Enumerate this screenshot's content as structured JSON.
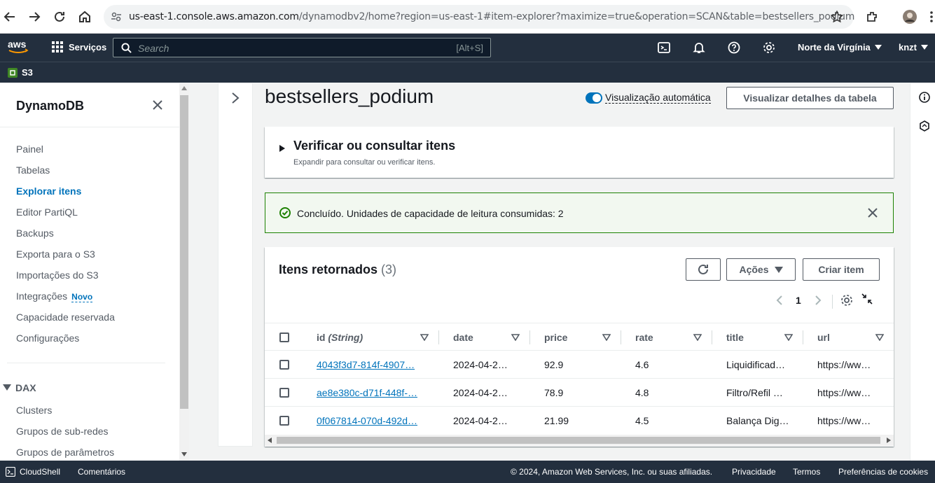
{
  "browser": {
    "url_host": "us-east-1.console.aws.amazon.com",
    "url_path": "/dynamodbv2/home?region=us-east-1#item-explorer?maximize=true&operation=SCAN&table=bestsellers_podium"
  },
  "header": {
    "logo": "aws",
    "services_label": "Serviços",
    "search_placeholder": "Search",
    "search_shortcut": "[Alt+S]",
    "region_label": "Norte da Virgínia",
    "user_label": "knzt"
  },
  "favorites": {
    "s3_label": "S3"
  },
  "sidebar": {
    "title": "DynamoDB",
    "items": [
      {
        "label": "Painel"
      },
      {
        "label": "Tabelas"
      },
      {
        "label": "Explorar itens"
      },
      {
        "label": "Editor PartiQL"
      },
      {
        "label": "Backups"
      },
      {
        "label": "Exporta para o S3"
      },
      {
        "label": "Importações do S3"
      },
      {
        "label": "Integrações",
        "badge": "Novo"
      },
      {
        "label": "Capacidade reservada"
      },
      {
        "label": "Configurações"
      }
    ],
    "dax_label": "DAX",
    "dax_items": [
      {
        "label": "Clusters"
      },
      {
        "label": "Grupos de sub-redes"
      },
      {
        "label": "Grupos de parâmetros"
      }
    ]
  },
  "main": {
    "table_name": "bestsellers_podium",
    "auto_view_label": "Visualização automática",
    "view_details_button": "Visualizar detalhes da tabela",
    "expand_title": "Verificar ou consultar itens",
    "expand_description": "Expandir para consultar ou verificar itens.",
    "flash_message": "Concluído. Unidades de capacidade de leitura consumidas: 2",
    "results_title": "Itens retornados",
    "results_count": "(3)",
    "actions_button": "Ações",
    "create_item_button": "Criar item",
    "page_number": "1",
    "columns": [
      {
        "name": "id",
        "type": "(String)"
      },
      {
        "name": "date",
        "type": ""
      },
      {
        "name": "price",
        "type": ""
      },
      {
        "name": "rate",
        "type": ""
      },
      {
        "name": "title",
        "type": ""
      },
      {
        "name": "url",
        "type": ""
      }
    ],
    "rows": [
      {
        "id": "4043f3d7-814f-4907…",
        "date": "2024-04-2…",
        "price": "92.9",
        "rate": "4.6",
        "title": "Liquidificad…",
        "url": "https://ww…"
      },
      {
        "id": "ae8e380c-d71f-448f-…",
        "date": "2024-04-2…",
        "price": "78.9",
        "rate": "4.8",
        "title": "Filtro/Refil …",
        "url": "https://ww…"
      },
      {
        "id": "0f067814-070d-492d…",
        "date": "2024-04-2…",
        "price": "21.99",
        "rate": "4.5",
        "title": "Balança Dig…",
        "url": "https://ww…"
      }
    ]
  },
  "footer": {
    "cloudshell": "CloudShell",
    "feedback": "Comentários",
    "copyright": "© 2024, Amazon Web Services, Inc. ou suas afiliadas.",
    "privacy": "Privacidade",
    "terms": "Termos",
    "cookies": "Preferências de cookies"
  },
  "colors": {
    "header_bg": "#232f3e",
    "link": "#0073bb",
    "success": "#1d8102",
    "success_bg": "#f2f8f0"
  }
}
